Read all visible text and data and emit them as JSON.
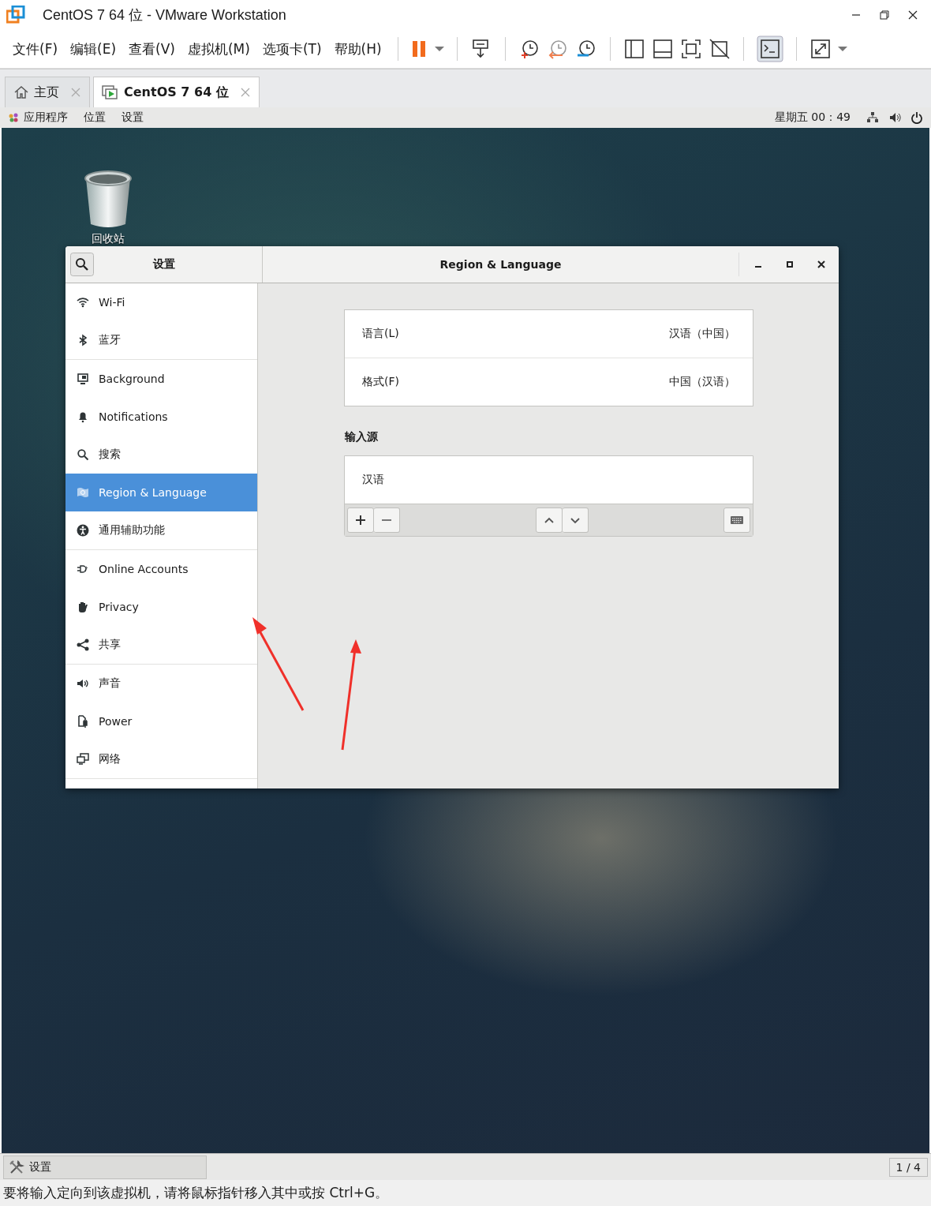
{
  "window": {
    "title": "CentOS 7 64 位 - VMware Workstation"
  },
  "menu": [
    "文件(F)",
    "编辑(E)",
    "查看(V)",
    "虚拟机(M)",
    "选项卡(T)",
    "帮助(H)"
  ],
  "tabs": [
    {
      "label": "主页",
      "selected": false
    },
    {
      "label": "CentOS 7 64 位",
      "selected": true
    }
  ],
  "guest_top_bar": {
    "menus": [
      "应用程序",
      "位置",
      "设置"
    ],
    "clock": "星期五 00：49"
  },
  "desktop_icons": [
    {
      "label": "回收站"
    }
  ],
  "settings_window": {
    "sidebar_title": "设置",
    "title": "Region & Language",
    "sidebar_sections": [
      {
        "items": [
          {
            "label": "Wi-Fi",
            "selected": false
          },
          {
            "label": "蓝牙",
            "selected": false
          }
        ]
      },
      {
        "items": [
          {
            "label": "Background",
            "selected": false
          },
          {
            "label": "Notifications",
            "selected": false
          },
          {
            "label": "搜索",
            "selected": false
          },
          {
            "label": "Region & Language",
            "selected": true
          },
          {
            "label": "通用辅助功能",
            "selected": false
          }
        ]
      },
      {
        "items": [
          {
            "label": "Online Accounts",
            "selected": false
          },
          {
            "label": "Privacy",
            "selected": false
          },
          {
            "label": "共享",
            "selected": false
          }
        ]
      },
      {
        "items": [
          {
            "label": "声音",
            "selected": false
          },
          {
            "label": "Power",
            "selected": false
          },
          {
            "label": "网络",
            "selected": false
          }
        ]
      }
    ],
    "rows": [
      {
        "label": "语言(L)",
        "value": "汉语（中国）"
      },
      {
        "label": "格式(F)",
        "value": "中国（汉语）"
      }
    ],
    "input_sources": {
      "heading": "输入源",
      "items": [
        "汉语"
      ]
    }
  },
  "taskbar": {
    "task": "设置",
    "workspace": "1 / 4"
  },
  "status_bar": "要将输入定向到该虚拟机，请将鼠标指针移入其中或按 Ctrl+G。"
}
